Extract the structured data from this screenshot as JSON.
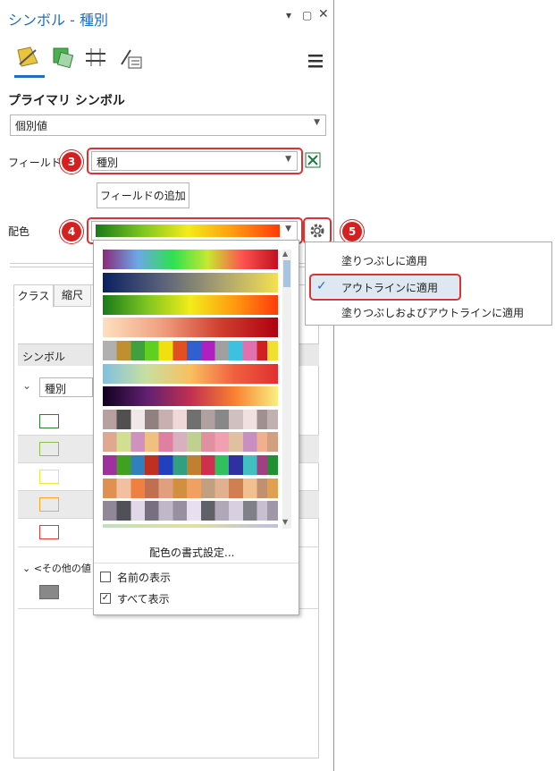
{
  "pane": {
    "title": "シンボル - 種別",
    "primary_symbol_heading": "プライマリ シンボル",
    "method_value": "個別値",
    "field_label": "フィールド 1",
    "field_value": "種別",
    "add_field_label": "フィールドの追加",
    "color_scheme_label": "配色",
    "tabs": [
      "クラス",
      "縮尺"
    ],
    "table_header": "シンボル",
    "group_value": "種別",
    "other_group_label": "<その他の値",
    "symbol_colors": [
      "#2e7d32",
      "#8bc34a",
      "#ffee58",
      "#ffa726",
      "#e53935"
    ],
    "other_symbol_color": "#888888"
  },
  "badges": [
    "3",
    "4",
    "5"
  ],
  "color_dropdown": {
    "format_link": "配色の書式設定...",
    "show_names_label": "名前の表示",
    "show_all_label": "すべて表示",
    "show_names_checked": false,
    "show_all_checked": true
  },
  "gear_menu": {
    "items": [
      "塗りつぶしに適用",
      "アウトラインに適用",
      "塗りつぶしおよびアウトラインに適用"
    ],
    "checked_index": 1
  },
  "icons": [
    "symbology-tab-icon",
    "vary-symbology-icon",
    "advanced-symbology-icon",
    "label-icon",
    "hamburger-menu-icon",
    "gear-icon",
    "excel-icon",
    "pin-icon",
    "maximize-icon",
    "close-icon"
  ]
}
